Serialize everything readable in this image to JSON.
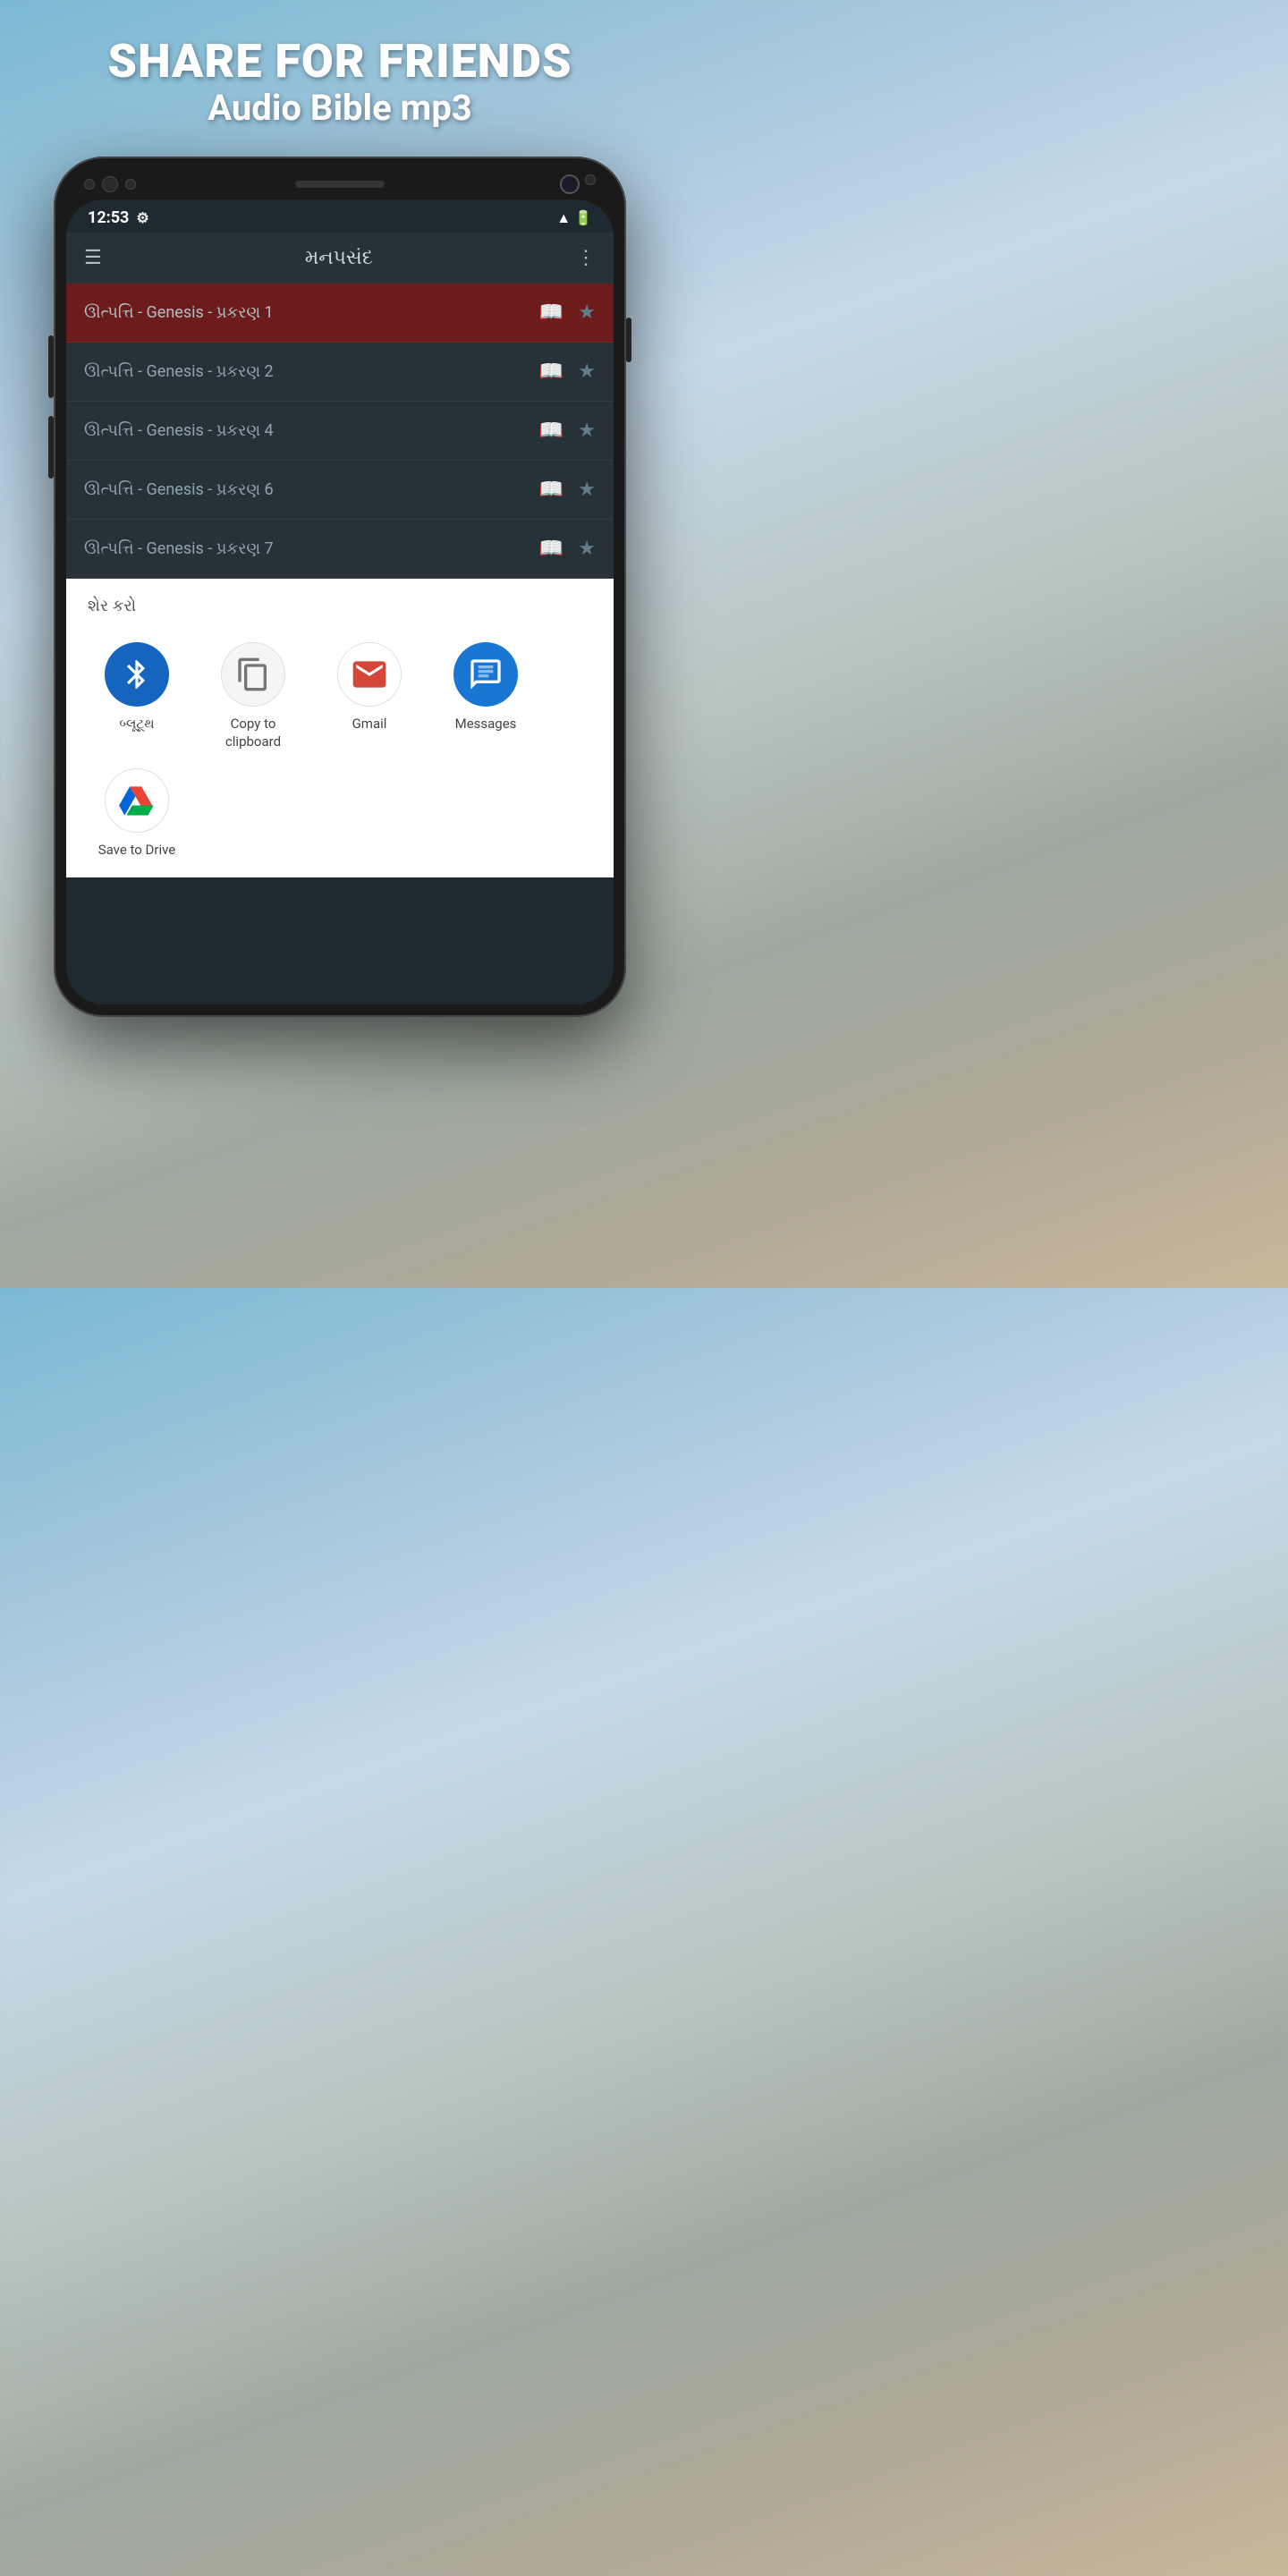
{
  "header": {
    "title": "SHARE FOR FRIENDS",
    "subtitle": "Audio Bible mp3"
  },
  "status_bar": {
    "time": "12:53",
    "signal": "▲",
    "battery": "🔋"
  },
  "app_bar": {
    "title": "મનપસંદ",
    "hamburger": "☰",
    "more": "⋮"
  },
  "list_items": [
    {
      "text": "ઊત્પત્તિ - Genesis - પ્રકરણ 1",
      "selected": true
    },
    {
      "text": "ઊત્પત્તિ - Genesis - પ્રકરણ 2",
      "selected": false
    },
    {
      "text": "ઊત્પત્તિ - Genesis - પ્રકરણ 4",
      "selected": false
    },
    {
      "text": "ઊત્પત્તિ - Genesis - પ્રકરણ 6",
      "selected": false
    },
    {
      "text": "ઊત્પત્તિ - Genesis - પ્રકરણ 7",
      "selected": false
    }
  ],
  "share_sheet": {
    "header": "શેર કરો",
    "items_row1": [
      {
        "id": "bluetooth",
        "label": "બ્લૂટૂથ",
        "icon_type": "bluetooth"
      },
      {
        "id": "clipboard",
        "label": "Copy to clipboard",
        "icon_type": "clipboard"
      },
      {
        "id": "gmail",
        "label": "Gmail",
        "icon_type": "gmail"
      },
      {
        "id": "messages",
        "label": "Messages",
        "icon_type": "messages"
      }
    ],
    "items_row2": [
      {
        "id": "drive",
        "label": "Save to Drive",
        "icon_type": "drive"
      }
    ]
  }
}
